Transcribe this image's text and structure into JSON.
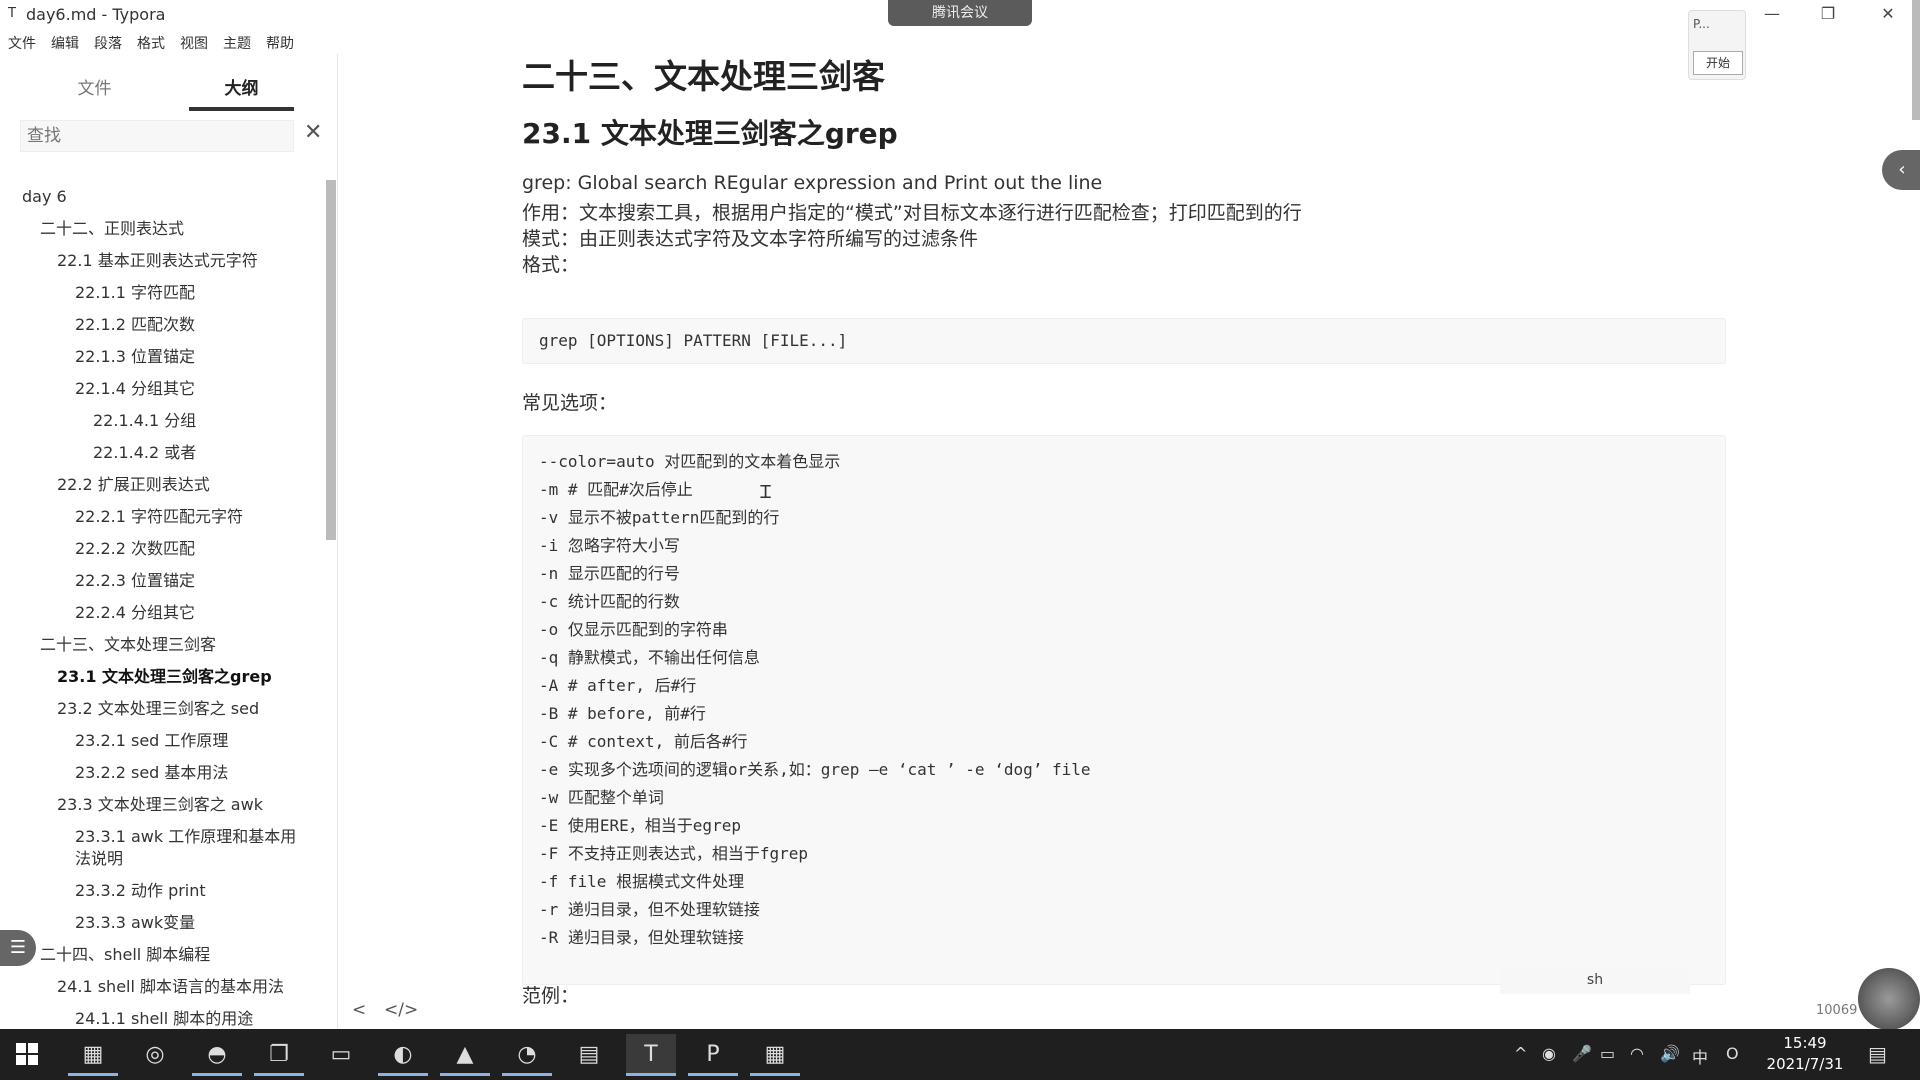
{
  "window": {
    "app_icon": "T",
    "title": "day6.md - Typora",
    "meeting_label": "腾讯会议",
    "controls": {
      "minimize": "—",
      "maximize": "❐",
      "close": "✕"
    }
  },
  "menu": [
    "文件",
    "编辑",
    "段落",
    "格式",
    "视图",
    "主题",
    "帮助"
  ],
  "sidebar": {
    "tabs": [
      {
        "label": "文件"
      },
      {
        "label": "大纲"
      }
    ],
    "search": {
      "placeholder": "查找",
      "clear": "✕"
    },
    "outline": [
      {
        "label": "day 6",
        "level": 0
      },
      {
        "label": "二十二、正则表达式",
        "level": 1
      },
      {
        "label": "22.1 基本正则表达式元字符",
        "level": 2
      },
      {
        "label": "22.1.1 字符匹配",
        "level": 3
      },
      {
        "label": "22.1.2 匹配次数",
        "level": 3
      },
      {
        "label": "22.1.3 位置锚定",
        "level": 3
      },
      {
        "label": "22.1.4 分组其它",
        "level": 3
      },
      {
        "label": "22.1.4.1 分组",
        "level": 4
      },
      {
        "label": "22.1.4.2 或者",
        "level": 4
      },
      {
        "label": "22.2 扩展正则表达式",
        "level": 2
      },
      {
        "label": "22.2.1 字符匹配元字符",
        "level": 3
      },
      {
        "label": "22.2.2 次数匹配",
        "level": 3
      },
      {
        "label": "22.2.3 位置锚定",
        "level": 3
      },
      {
        "label": "22.2.4 分组其它",
        "level": 3
      },
      {
        "label": "二十三、文本处理三剑客",
        "level": 1
      },
      {
        "label": "23.1 文本处理三剑客之grep",
        "level": 2,
        "active": true
      },
      {
        "label": "23.2 文本处理三剑客之 sed",
        "level": 2
      },
      {
        "label": "23.2.1 sed 工作原理",
        "level": 3
      },
      {
        "label": "23.2.2 sed 基本用法",
        "level": 3
      },
      {
        "label": "23.3 文本处理三剑客之 awk",
        "level": 2
      },
      {
        "label": "23.3.1 awk 工作原理和基本用",
        "label2": "法说明",
        "level": 3
      },
      {
        "label": "23.3.2 动作 print",
        "level": 3
      },
      {
        "label": "23.3.3 awk变量",
        "level": 3
      },
      {
        "label": "二十四、shell 脚本编程",
        "level": 1
      },
      {
        "label": "24.1 shell 脚本语言的基本用法",
        "level": 2
      },
      {
        "label": "24.1.1 shell 脚本的用途",
        "level": 3
      }
    ]
  },
  "doc": {
    "h1": "二十三、文本处理三剑客",
    "h2": "23.1 文本处理三剑客之grep",
    "lines": [
      "grep: Global search REgular expression and Print out the line",
      "作用：文本搜索工具，根据用户指定的“模式”对目标文本逐行进行匹配检查；打印匹配到的行",
      "模式：由正则表达式字符及文本字符所编写的过滤条件",
      "格式："
    ],
    "format_code": "grep [OPTIONS] PATTERN [FILE...]",
    "options_heading": "常见选项：",
    "options": [
      "--color=auto 对匹配到的文本着色显示",
      "-m # 匹配#次后停止",
      "-v 显示不被pattern匹配到的行",
      "-i 忽略字符大小写",
      "-n 显示匹配的行号",
      "-c 统计匹配的行数",
      "-o 仅显示匹配到的字符串",
      "-q 静默模式，不输出任何信息",
      "-A # after, 后#行",
      "-B # before, 前#行",
      "-C # context, 前后各#行",
      "-e 实现多个选项间的逻辑or关系,如：grep –e ‘cat ’ -e ‘dog’ file",
      "-w 匹配整个单词",
      "-E 使用ERE，相当于egrep",
      "-F 不支持正则表达式，相当于fgrep",
      "-f file 根据模式文件处理",
      "-r 递归目录，但不处理软链接",
      "-R 递归目录，但处理软链接"
    ],
    "code_lang": "sh",
    "example_heading": "范例："
  },
  "footer": {
    "back_icon": "<",
    "source_icon": "</>",
    "word_count": "10069"
  },
  "float_widget": {
    "top_text": "P...",
    "button": "开始"
  },
  "taskbar": {
    "apps": [
      "app-1",
      "app-2",
      "wechat",
      "app-4",
      "app-5",
      "app-6",
      "app-7",
      "app-8",
      "app-9",
      "typora",
      "powerpoint",
      "app-12"
    ],
    "tray": [
      "^",
      "◉",
      "🎤",
      "▭",
      "◠",
      "🔊",
      "中",
      "O"
    ],
    "time": "15:49",
    "date": "2021/7/31"
  }
}
